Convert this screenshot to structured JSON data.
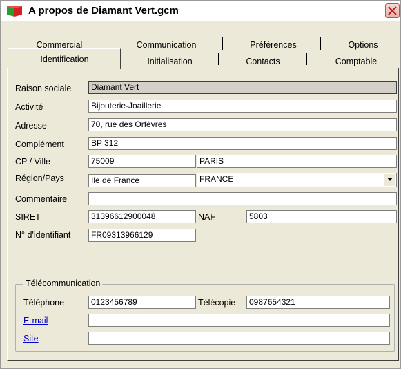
{
  "window": {
    "title": "A propos de Diamant Vert.gcm"
  },
  "tabs": {
    "row1": [
      "Commercial",
      "Communication",
      "Préférences",
      "Options"
    ],
    "row2": [
      "Identification",
      "Initialisation",
      "Contacts",
      "Comptable"
    ],
    "active": "Identification"
  },
  "form": {
    "raison_sociale": {
      "label": "Raison sociale",
      "value": "Diamant Vert"
    },
    "activite": {
      "label": "Activité",
      "value": "Bijouterie-Joaillerie"
    },
    "adresse": {
      "label": "Adresse",
      "value": "70, rue des Orfèvres"
    },
    "complement": {
      "label": "Complément",
      "value": "BP 312"
    },
    "cp_ville": {
      "label": "CP / Ville",
      "cp": "75009",
      "ville": "PARIS"
    },
    "region_pays": {
      "label": "Région/Pays",
      "region": "Ile de France",
      "pays": "FRANCE"
    },
    "commentaire": {
      "label": "Commentaire",
      "value": ""
    },
    "siret": {
      "label": "SIRET",
      "value": "31396612900048"
    },
    "naf": {
      "label": "NAF",
      "value": "5803"
    },
    "identifiant": {
      "label": "N° d'identifiant",
      "value": "FR09313966129"
    }
  },
  "telecom": {
    "group_title": "Télécommunication",
    "telephone": {
      "label": "Téléphone",
      "value": "0123456789"
    },
    "telecopie": {
      "label": "Télécopie",
      "value": "0987654321"
    },
    "email": {
      "label": "E-mail",
      "value": ""
    },
    "site": {
      "label": "Site",
      "value": ""
    }
  },
  "icons": {
    "app": "gem-book-icon",
    "close": "close-icon",
    "dropdown": "chevron-down-icon"
  }
}
